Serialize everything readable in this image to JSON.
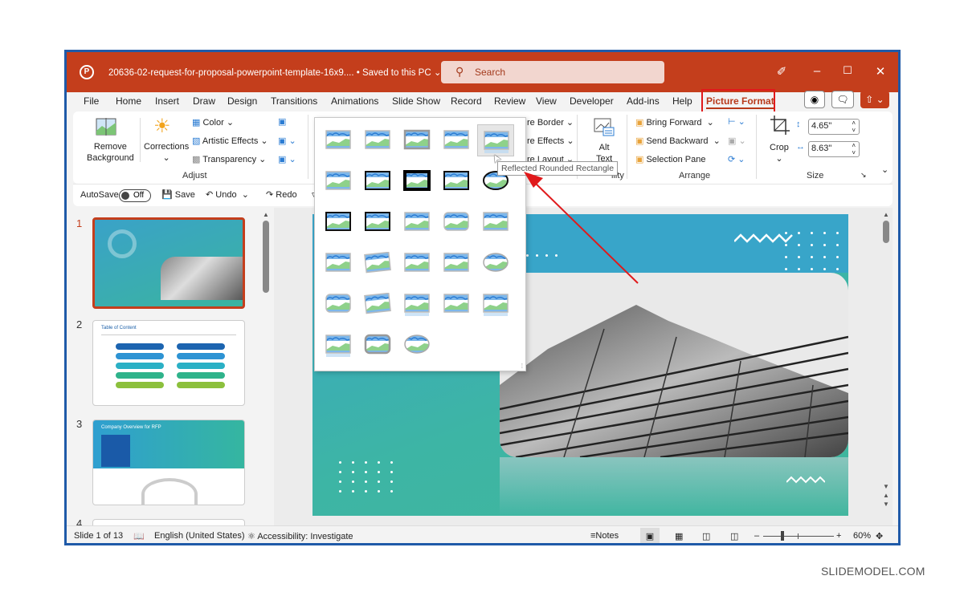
{
  "titlebar": {
    "app_icon": "powerpoint-logo-icon",
    "document_name": "20636-02-request-for-proposal-powerpoint-template-16x9....",
    "save_status": "• Saved to this PC",
    "search_placeholder": "Search",
    "controls": [
      "pen-icon",
      "minimize-icon",
      "maximize-icon",
      "close-icon"
    ]
  },
  "menu": {
    "tabs": [
      "File",
      "Home",
      "Insert",
      "Draw",
      "Design",
      "Transitions",
      "Animations",
      "Slide Show",
      "Record",
      "Review",
      "View",
      "Developer",
      "Add-ins",
      "Help",
      "Picture Format"
    ],
    "active_tab": "Picture Format",
    "accent_color": "#c43e1c"
  },
  "ribbon": {
    "adjust": {
      "label": "Adjust",
      "remove_background": [
        "Remove",
        "Background"
      ],
      "corrections": "Corrections",
      "color": "Color",
      "artistic_effects": "Artistic Effects",
      "transparency": "Transparency"
    },
    "picture_styles": {
      "picture_border": "re Border",
      "picture_effects": "re Effects",
      "picture_layout": "re Layout"
    },
    "accessibility": {
      "alt_text": [
        "Alt",
        "Text"
      ],
      "label": "ility"
    },
    "arrange": {
      "label": "Arrange",
      "bring_forward": "Bring Forward",
      "send_backward": "Send Backward",
      "selection_pane": "Selection Pane"
    },
    "size": {
      "label": "Size",
      "crop": "Crop",
      "height": "4.65\"",
      "width": "8.63\""
    }
  },
  "qat": {
    "autosave_label": "AutoSave",
    "autosave_state": "Off",
    "save": "Save",
    "undo": "Undo",
    "redo": "Redo"
  },
  "gallery": {
    "tooltip": "Reflected Rounded Rectangle",
    "hovered_index": 4,
    "styles": [
      "Simple Frame, White",
      "Beveled Matte, White",
      "Metal Frame",
      "Drop Shadow Rectangle",
      "Reflected Rounded Rectangle",
      "Soft Edge Rectangle",
      "Double Frame, Black",
      "Thick Matte, Black",
      "Simple Frame, Black",
      "Beveled Oval, Black",
      "Compound Frame, Black",
      "Moderate Frame, Black",
      "Center Shadow Rectangle",
      "Rounded Diagonal Corner, White",
      "Snip Diagonal Corner, White",
      "Moderate Frame, White",
      "Rotated, White",
      "Perspective Shadow, White",
      "Relaxed Perspective, White",
      "Soft Edge Oval",
      "Bevel Rectangle",
      "Bevel Perspective",
      "Reflected Perspective Right",
      "Bevel Perspective Left, White",
      "Reflected Bevel, Black",
      "Reflected Bevel, White",
      "Metal Rounded Rectangle",
      "Metal Oval"
    ]
  },
  "slides_pane": {
    "slides": [
      {
        "number": "1",
        "title": ""
      },
      {
        "number": "2",
        "title": "Table of Content"
      },
      {
        "number": "3",
        "title": "Company Overview for RFP"
      },
      {
        "number": "4",
        "title": ""
      }
    ],
    "selected": 1
  },
  "statusbar": {
    "slide_indicator": "Slide 1 of 13",
    "language": "English (United States)",
    "accessibility": "Accessibility: Investigate",
    "notes": "Notes",
    "zoom": "60%",
    "zoom_fraction": 0.6
  },
  "annotation": {
    "arrow_color": "#e0191b"
  },
  "watermark": "SLIDEMODEL.COM"
}
